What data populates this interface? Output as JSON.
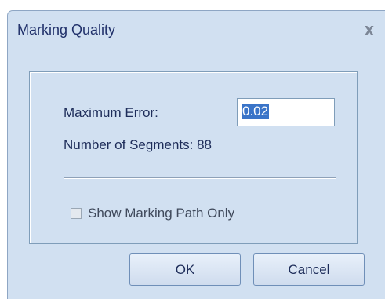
{
  "window": {
    "title": "Marking Quality",
    "close_glyph": "x"
  },
  "form": {
    "max_error_label": "Maximum Error:",
    "max_error_value": "0.02",
    "segments_label": "Number of Segments: 88",
    "show_path_only_label": "Show Marking Path Only",
    "show_path_only_checked": false
  },
  "buttons": {
    "ok": "OK",
    "cancel": "Cancel"
  }
}
